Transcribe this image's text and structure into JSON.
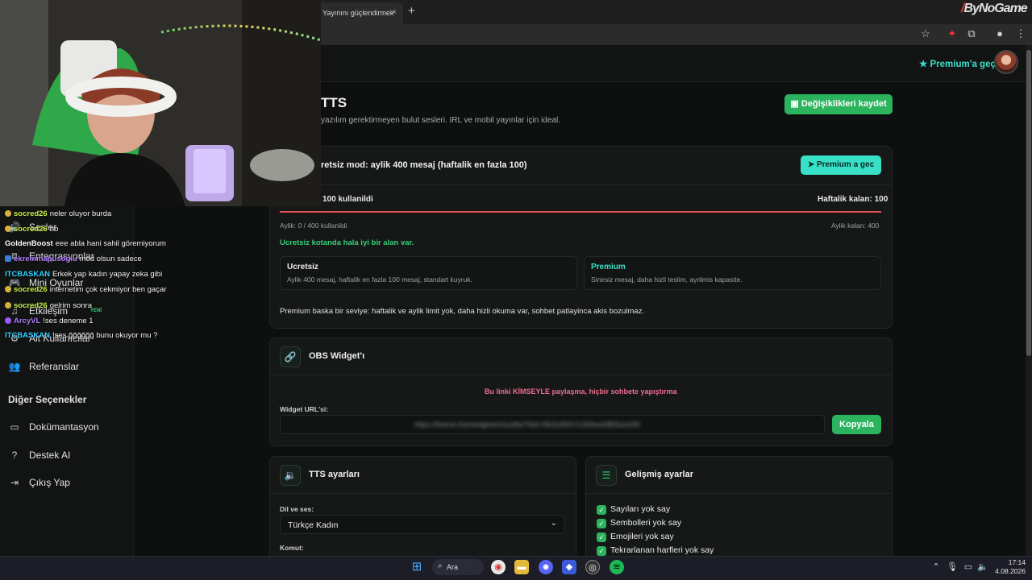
{
  "browser": {
    "tab_title": "Yayınını güçlendirmek",
    "tab_close": "×",
    "new_tab": "+",
    "brand_prefix": "/",
    "brand": "ByNoGame"
  },
  "topbar": {
    "premium_link": "Premium'a geç"
  },
  "sidebar": {
    "items": [
      {
        "label": "Sesler",
        "icon": "volume-icon"
      },
      {
        "label": "Entegrasyonlar",
        "icon": "plug-icon"
      },
      {
        "label": "Mini Oyunlar",
        "icon": "gamepad-icon"
      },
      {
        "label": "Etkileşim",
        "icon": "music-icon",
        "badge": "YENİ"
      },
      {
        "label": "Alt Kullanıcılar",
        "icon": "users-icon"
      },
      {
        "label": "Referanslar",
        "icon": "people-icon"
      }
    ],
    "section_title": "Diğer Seçenekler",
    "other": [
      {
        "label": "Dokümantasyon",
        "icon": "doc-icon"
      },
      {
        "label": "Destek AI",
        "icon": "help-icon"
      },
      {
        "label": "Çıkış Yap",
        "icon": "logout-icon"
      }
    ]
  },
  "page": {
    "title": "TTS",
    "subtitle": "yazılım gerektirmeyen bulut sesleri. IRL ve mobil yayınlar için ideal.",
    "save_button": "Değişiklikleri kaydet"
  },
  "quota": {
    "mode_title": "retsiz mod: aylik 400 mesaj (haftalik en fazla 100)",
    "premium_button": "Premium a gec",
    "weekly_used": "100 kullanildi",
    "weekly_left": "Haftalik kalan: 100",
    "monthly_used": "Aylik: 0 / 400 kullanildi",
    "monthly_left": "Aylik kalan: 400",
    "status": "Ucretsiz kotanda hala iyi bir alan var.",
    "weekly_progress": 1.0,
    "monthly_progress": 0.0,
    "free_title": "Ucretsiz",
    "free_desc": "Aylik 400 mesaj, haftalik en fazla 100 mesaj, standart kuyruk.",
    "premium_title": "Premium",
    "premium_desc": "Sinirsiz mesaj, daha hizli teslim, ayrilmis kapasite.",
    "footer": "Premium baska bir seviye: haftalik ve aylik limit yok, daha hizli okuma var, sohbet patlayinca akis bozulmaz."
  },
  "widget": {
    "title": "OBS Widget'ı",
    "warning": "Bu linki KİMSEYLE paylaşma, hiçbir sohbete yapıştırma",
    "url_label": "Widget URL'si:",
    "url_value": "https://bolme.live/widgets/cloudtts/?kid=f4k3u9f2h7c2b9ra4d8f3a1e0f2",
    "copy_button": "Kopyala"
  },
  "tts_settings": {
    "title": "TTS ayarları",
    "voice_label": "Dil ve ses:",
    "voice_value": "Türkçe Kadın",
    "command_label": "Komut:"
  },
  "advanced": {
    "title": "Gelişmiş ayarlar",
    "options": [
      "Sayıları yok say",
      "Sembolleri yok say",
      "Emojileri yok say",
      "Tekrarlanan harfleri yok say"
    ]
  },
  "chat": [
    {
      "user": "socred26",
      "msg": "neler oluyor burda",
      "color": "#c8f04a"
    },
    {
      "user": "socred26",
      "msg": "hb",
      "color": "#c8f04a"
    },
    {
      "user": "GoldenBoost",
      "msg": "eee abla hani sahil göremiyorum",
      "color": "#ffffff"
    },
    {
      "user": "ekremmapusoglu",
      "msg": "mod olsun sadece",
      "color": "#b07cff"
    },
    {
      "user": "ITCBASKAN",
      "msg": "Erkek yap kadın yapay zeka gibi",
      "color": "#33d0ff"
    },
    {
      "user": "socred26",
      "msg": "internetim çok cekmiyor ben gaçar",
      "color": "#c8f04a"
    },
    {
      "user": "socred26",
      "msg": "gelrim sonra",
      "color": "#c8f04a"
    },
    {
      "user": "ArcyVL",
      "msg": "!ses deneme 1",
      "color": "#b07cff"
    },
    {
      "user": "ITCBASKAN",
      "msg": "!ses ğğğğğğ bunu okuyor mu ?",
      "color": "#33d0ff"
    }
  ],
  "taskbar": {
    "search": "Ara",
    "time": "17:14",
    "date": "4.08.2026"
  }
}
